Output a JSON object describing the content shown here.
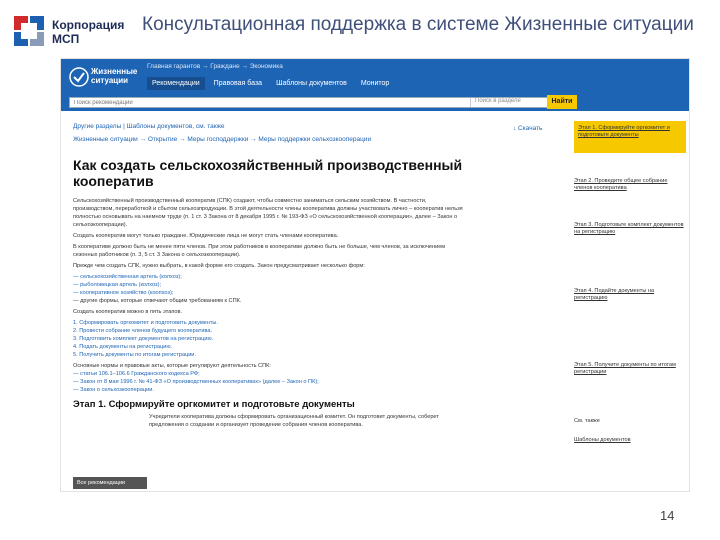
{
  "slide": {
    "org_line1": "Корпорация",
    "org_line2": "МСП",
    "title": "Консультационная поддержка в системе Жизненные ситуации",
    "page_number": "14"
  },
  "app": {
    "brand_line1": "Жизненные",
    "brand_line2": "ситуации",
    "top_links": "Главная гарантов → Граждане → Экономика",
    "tabs": [
      {
        "label": "Рекомендации"
      },
      {
        "label": "Правовая база"
      },
      {
        "label": "Шаблоны документов"
      },
      {
        "label": "Монитор"
      }
    ],
    "search_placeholder": "Поиск рекомендаций",
    "search_scope": "Поиск в разделе",
    "search_button": "Найти"
  },
  "article": {
    "breadcrumb1": "Другие разделы | Шаблоны документов, см. также",
    "breadcrumb2": "Жизненные ситуации → Открытие → Меры господдержки → Меры поддержки сельхозкооперации",
    "download": "↓ Скачать",
    "title": "Как создать сельскохозяйственный производственный кооператив",
    "para1": "Сельскохозяйственный производственный кооператив (СПК) создают, чтобы совместно заниматься сельским хозяйством. В частности, производством, переработкой и сбытом сельхозпродукции. В этой деятельности члены кооператива должны участвовать лично – кооператив нельзя полностью основывать на наемном труде (п. 1 ст. 3 Закона от 8 декабря 1995 г. № 193-ФЗ «О сельскохозяйственной кооперации», далее – Закон о сельхозкооперации).",
    "para2": "Создать кооператив могут только граждане. Юридические лица не могут стать членами кооператива.",
    "para3": "В кооперативе должно быть не менее пяти членов. При этом работников в кооперативе должно быть не больше, чем членов, за исключением сезонных работников (п. 3, 5 ст. 3 Закона о сельхозкооперации).",
    "para4": "Прежде чем создать СПК, нужно выбрать, в какой форме его создать. Закон предусматривает несколько форм:",
    "forms": [
      "— сельскохозяйственная артель (колхоз);",
      "— рыболовецкая артель (колхоз);",
      "— кооперативное хозяйство (коопхоз);"
    ],
    "forms_other": "— другие формы, которые отвечают общим требованиям к СПК.",
    "stages_intro": "Создать кооператив можно в пять этапов.",
    "stages": [
      "1. Сформировать оргкомитет и подготовить документы.",
      "2. Провести собрание членов будущего кооператива.",
      "3. Подготовить комплект документов на регистрацию.",
      "4. Подать документы на регистрацию.",
      "5. Получить документы по итогам регистрации."
    ],
    "law_intro": "Основные нормы и правовые акты, которые регулируют деятельность СПК:",
    "laws": [
      "— статьи 106.1–106.6 Гражданского кодекса РФ;",
      "— Закон от 8 мая 1996 г. № 41-ФЗ «О производственных кооперативах» (далее – Закон о ПК);",
      "— Закон о сельхозкооперации."
    ],
    "stage1_title": "Этап 1. Сформируйте оргкомитет и подготовьте документы",
    "stage1_text": "Учредители кооператива должны сформировать организационный комитет. Он подготовит документы, соберет предложения о создании и организует проведение собрания членов кооператива.",
    "tooltip": "Все рекомендации"
  },
  "aside": {
    "items": [
      {
        "label": "Этап 1. Сформируйте оргкомитет и подготовьте документы"
      },
      {
        "label": "Этап 2. Проведите общее собрание членов кооператива"
      },
      {
        "label": "Этап 3. Подготовьте комплект документов на регистрацию"
      },
      {
        "label": "Этап 4. Подайте документы на регистрацию"
      },
      {
        "label": "Этап 5. Получите документы по итогам регистрации"
      }
    ],
    "see_also": "См. также",
    "templates": "Шаблоны документов"
  },
  "colors": {
    "header_blue": "#1e64b4",
    "accent_yellow": "#f6c800"
  }
}
